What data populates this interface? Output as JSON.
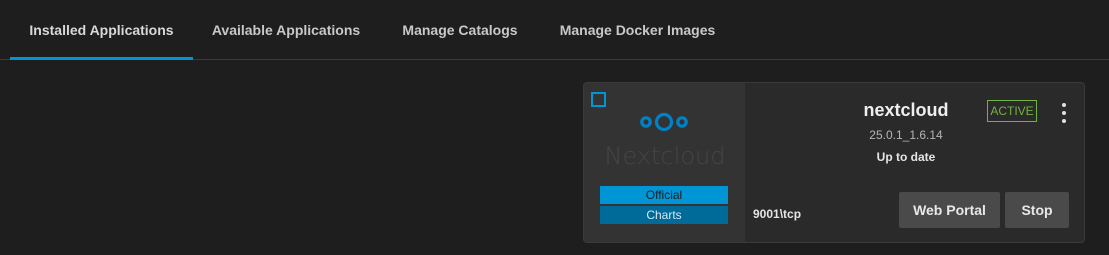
{
  "tabs": [
    {
      "label": "Installed Applications",
      "active": true
    },
    {
      "label": "Available Applications",
      "active": false
    },
    {
      "label": "Manage Catalogs",
      "active": false
    },
    {
      "label": "Manage Docker Images",
      "active": false
    }
  ],
  "app": {
    "logo": "nextcloud-logo",
    "logo_text": "Nextcloud",
    "name": "nextcloud",
    "version": "25.0.1_1.6.14",
    "update_status": "Up to date",
    "status": "ACTIVE",
    "port": "9001\\tcp",
    "catalog_badge": "Official",
    "train_badge": "Charts",
    "web_portal_label": "Web Portal",
    "stop_label": "Stop",
    "menu_icon": "more-vert-icon"
  },
  "colors": {
    "accent": "#0095d5",
    "status_active": "#71b341",
    "background": "#1e1e1e",
    "card": "#2a2a2a"
  }
}
